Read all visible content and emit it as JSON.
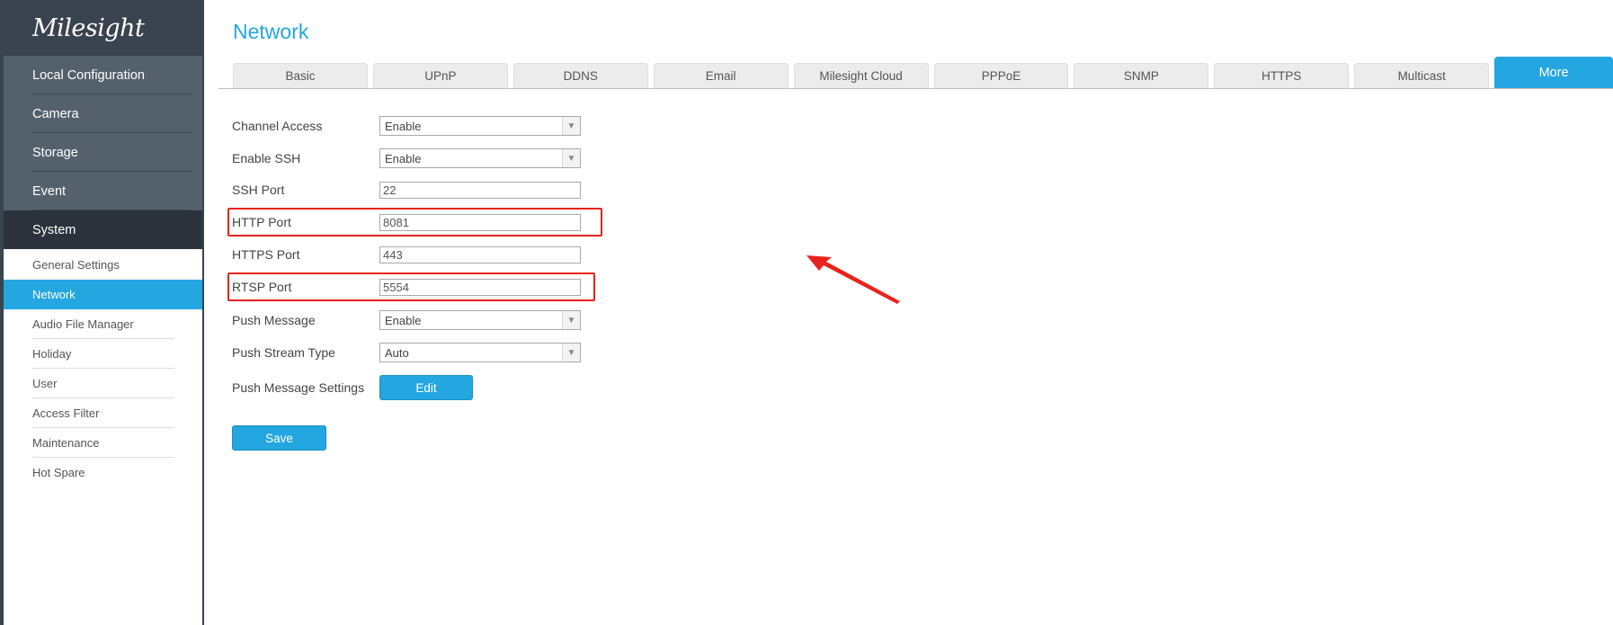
{
  "brand": {
    "logo": "Milesight"
  },
  "sidebar": {
    "main_items": [
      {
        "label": "Local Configuration"
      },
      {
        "label": "Camera"
      },
      {
        "label": "Storage"
      },
      {
        "label": "Event"
      },
      {
        "label": "System"
      }
    ],
    "sub_items": [
      {
        "label": "General Settings"
      },
      {
        "label": "Network"
      },
      {
        "label": "Audio File Manager"
      },
      {
        "label": "Holiday"
      },
      {
        "label": "User"
      },
      {
        "label": "Access Filter"
      },
      {
        "label": "Maintenance"
      },
      {
        "label": "Hot Spare"
      }
    ]
  },
  "page": {
    "title": "Network"
  },
  "tabs": [
    {
      "label": "Basic"
    },
    {
      "label": "UPnP"
    },
    {
      "label": "DDNS"
    },
    {
      "label": "Email"
    },
    {
      "label": "Milesight Cloud"
    },
    {
      "label": "PPPoE"
    },
    {
      "label": "SNMP"
    },
    {
      "label": "HTTPS"
    },
    {
      "label": "Multicast"
    },
    {
      "label": "More"
    }
  ],
  "form": {
    "channel_access": {
      "label": "Channel Access",
      "value": "Enable"
    },
    "enable_ssh": {
      "label": "Enable SSH",
      "value": "Enable"
    },
    "ssh_port": {
      "label": "SSH Port",
      "value": "22"
    },
    "http_port": {
      "label": "HTTP Port",
      "value": "8081"
    },
    "https_port": {
      "label": "HTTPS Port",
      "value": "443"
    },
    "rtsp_port": {
      "label": "RTSP Port",
      "value": "5554"
    },
    "push_message": {
      "label": "Push Message",
      "value": "Enable"
    },
    "push_stream_type": {
      "label": "Push Stream Type",
      "value": "Auto"
    },
    "push_message_settings": {
      "label": "Push Message Settings",
      "button": "Edit"
    }
  },
  "actions": {
    "save": "Save"
  },
  "colors": {
    "accent": "#24a6e0",
    "sidebar_dark": "#3a4350",
    "annotation": "#e8231e"
  }
}
